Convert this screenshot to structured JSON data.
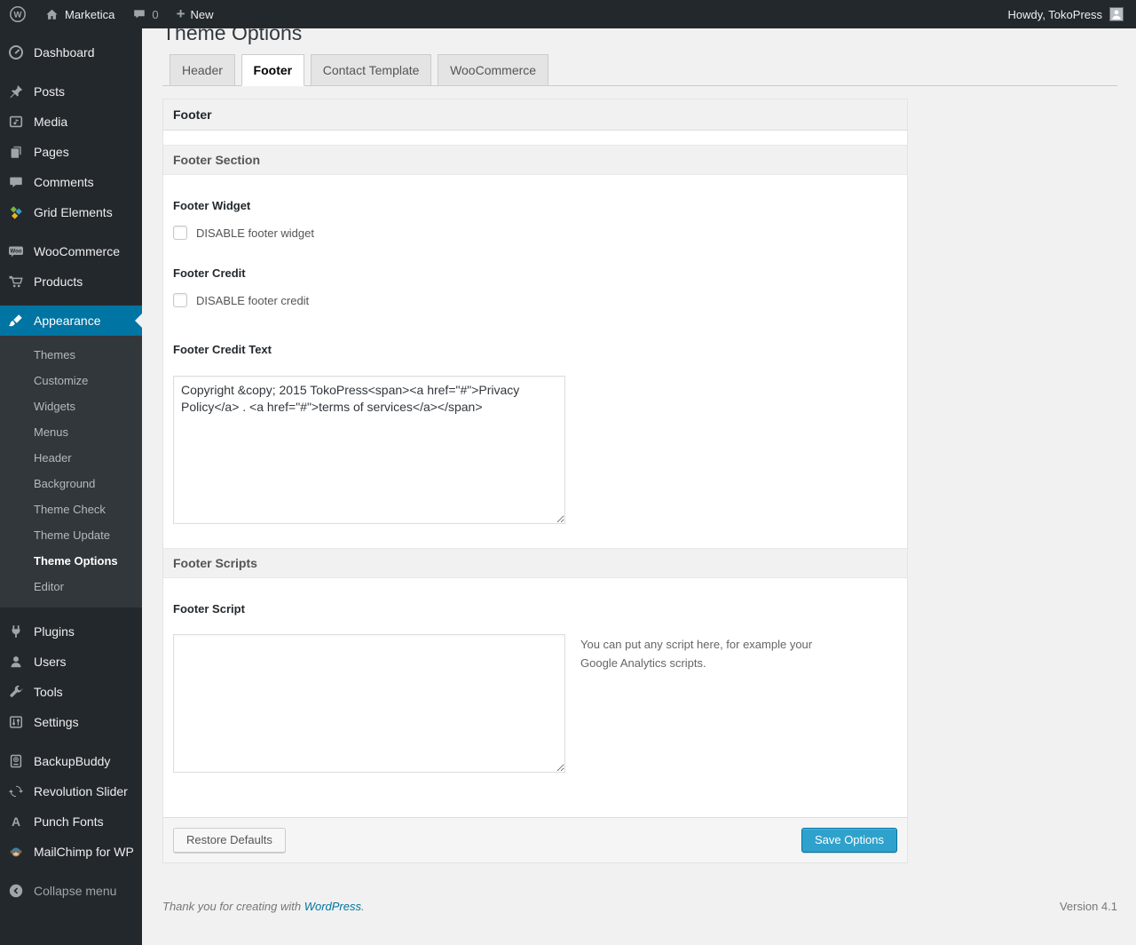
{
  "admin_bar": {
    "site_name": "Marketica",
    "comments_count": "0",
    "new_label": "New",
    "howdy": "Howdy, TokoPress"
  },
  "sidebar": {
    "items": [
      {
        "label": "Dashboard",
        "icon": "dashboard-gauge-icon"
      },
      {
        "label": "Posts",
        "icon": "pushpin-icon"
      },
      {
        "label": "Media",
        "icon": "media-icon"
      },
      {
        "label": "Pages",
        "icon": "pages-icon"
      },
      {
        "label": "Comments",
        "icon": "comment-bubble-icon"
      },
      {
        "label": "Grid Elements",
        "icon": "grid-pinwheel-icon"
      },
      {
        "label": "WooCommerce",
        "icon": "woocommerce-badge-icon"
      },
      {
        "label": "Products",
        "icon": "shopping-cart-icon"
      },
      {
        "label": "Appearance",
        "icon": "paintbrush-icon",
        "active": true
      },
      {
        "label": "Plugins",
        "icon": "plug-icon"
      },
      {
        "label": "Users",
        "icon": "user-icon"
      },
      {
        "label": "Tools",
        "icon": "wrench-icon"
      },
      {
        "label": "Settings",
        "icon": "sliders-icon"
      },
      {
        "label": "BackupBuddy",
        "icon": "backup-drive-icon"
      },
      {
        "label": "Revolution Slider",
        "icon": "refresh-arrows-icon"
      },
      {
        "label": "Punch Fonts",
        "icon": "letter-a-icon"
      },
      {
        "label": "MailChimp for WP",
        "icon": "mailchimp-monkey-icon"
      },
      {
        "label": "Collapse menu",
        "icon": "collapse-arrow-icon"
      }
    ],
    "icon_texts": {
      "woocommerce": "Woo",
      "punch_fonts": "A"
    },
    "appearance_submenu": [
      "Themes",
      "Customize",
      "Widgets",
      "Menus",
      "Header",
      "Background",
      "Theme Check",
      "Theme Update",
      "Theme Options",
      "Editor"
    ],
    "submenu_current": "Theme Options"
  },
  "page": {
    "title": "Theme Options",
    "tabs": [
      {
        "label": "Header",
        "active": false
      },
      {
        "label": "Footer",
        "active": true
      },
      {
        "label": "Contact Template",
        "active": false
      },
      {
        "label": "WooCommerce",
        "active": false
      }
    ],
    "box_header": "Footer",
    "sections": {
      "footer_section": {
        "title": "Footer Section",
        "footer_widget_label": "Footer Widget",
        "footer_widget_checkbox_label": "DISABLE footer widget",
        "footer_widget_checked": false,
        "footer_credit_label": "Footer Credit",
        "footer_credit_checkbox_label": "DISABLE footer credit",
        "footer_credit_checked": false,
        "footer_credit_text_label": "Footer Credit Text",
        "footer_credit_text_value": "Copyright &copy; 2015 TokoPress<span><a href=\"#\">Privacy Policy</a> . <a href=\"#\">terms of services</a></span>"
      },
      "footer_scripts": {
        "title": "Footer Scripts",
        "footer_script_label": "Footer Script",
        "footer_script_value": "",
        "footer_script_help": "You can put any script here, for example your Google Analytics scripts."
      }
    },
    "buttons": {
      "restore": "Restore Defaults",
      "save": "Save Options"
    }
  },
  "page_footer": {
    "thanks_prefix": "Thank you for creating with ",
    "thanks_link": "WordPress",
    "thanks_suffix": ".",
    "version": "Version 4.1"
  },
  "colors": {
    "accent_blue": "#0074a2",
    "primary_button_blue": "#2ea2cc",
    "admin_bar_bg": "#23282d",
    "submenu_bg": "#32373c",
    "page_bg": "#f1f1f1"
  }
}
